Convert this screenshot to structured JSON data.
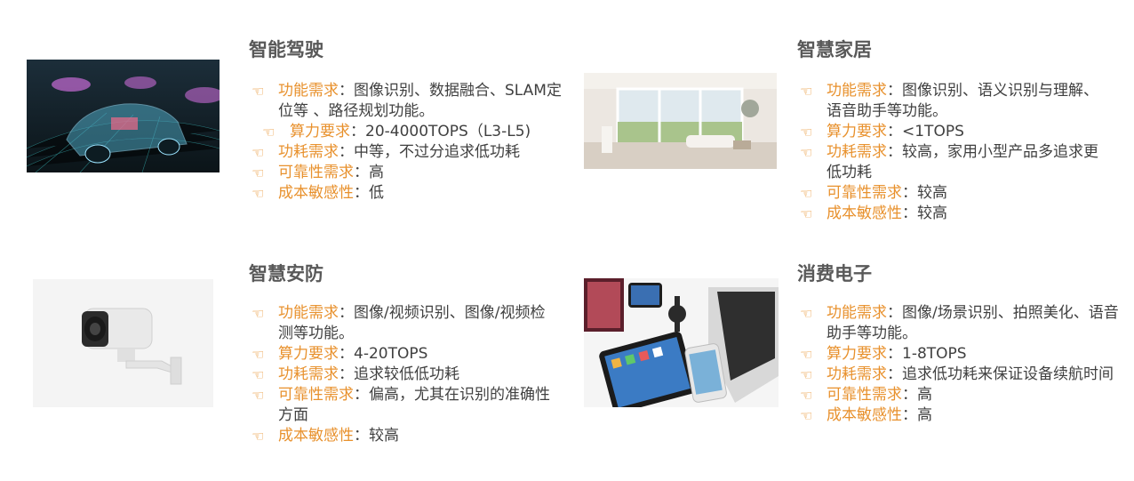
{
  "sections": [
    {
      "title": "智能驾驶",
      "items": [
        {
          "key": "功能需求",
          "value": "图像识别、数据融合、SLAM定位等 、路径规划功能。"
        },
        {
          "key": "算力要求",
          "value": "20-4000TOPS（L3-L5)"
        },
        {
          "key": "功耗需求",
          "value": "中等，不过分追求低功耗"
        },
        {
          "key": "可靠性需求",
          "value": "高"
        },
        {
          "key": "成本敏感性",
          "value": "低"
        }
      ],
      "image_icon": "autonomous-car-image"
    },
    {
      "title": "智慧家居",
      "items": [
        {
          "key": "功能需求",
          "value": "图像识别、语义识别与理解、语音助手等功能。"
        },
        {
          "key": "算力要求",
          "value": "<1TOPS"
        },
        {
          "key": "功耗需求",
          "value": "较高，家用小型产品多追求更低功耗"
        },
        {
          "key": "可靠性需求",
          "value": "较高"
        },
        {
          "key": "成本敏感性",
          "value": "较高"
        }
      ],
      "image_icon": "smart-living-room-image"
    },
    {
      "title": "智慧安防",
      "items": [
        {
          "key": "功能需求",
          "value": "图像/视频识别、图像/视频检测等功能。"
        },
        {
          "key": "算力要求",
          "value": "4-20TOPS"
        },
        {
          "key": "功耗需求",
          "value": "追求较低低功耗"
        },
        {
          "key": "可靠性需求",
          "value": "偏高，尤其在识别的准确性方面"
        },
        {
          "key": "成本敏感性",
          "value": "较高"
        }
      ],
      "image_icon": "security-camera-image"
    },
    {
      "title": "消费电子",
      "items": [
        {
          "key": "功能需求",
          "value": "图像/场景识别、拍照美化、语音助手等功能。"
        },
        {
          "key": "算力要求",
          "value": "1-8TOPS"
        },
        {
          "key": "功耗需求",
          "value": "追求低功耗来保证设备续航时间"
        },
        {
          "key": "可靠性需求",
          "value": "高"
        },
        {
          "key": "成本敏感性",
          "value": "高"
        }
      ],
      "image_icon": "consumer-devices-image"
    }
  ],
  "bullet_icon": "pointing-hand-icon",
  "separator": "：",
  "colors": {
    "accent": "#e8912d",
    "title": "#595959",
    "text": "#404040"
  }
}
